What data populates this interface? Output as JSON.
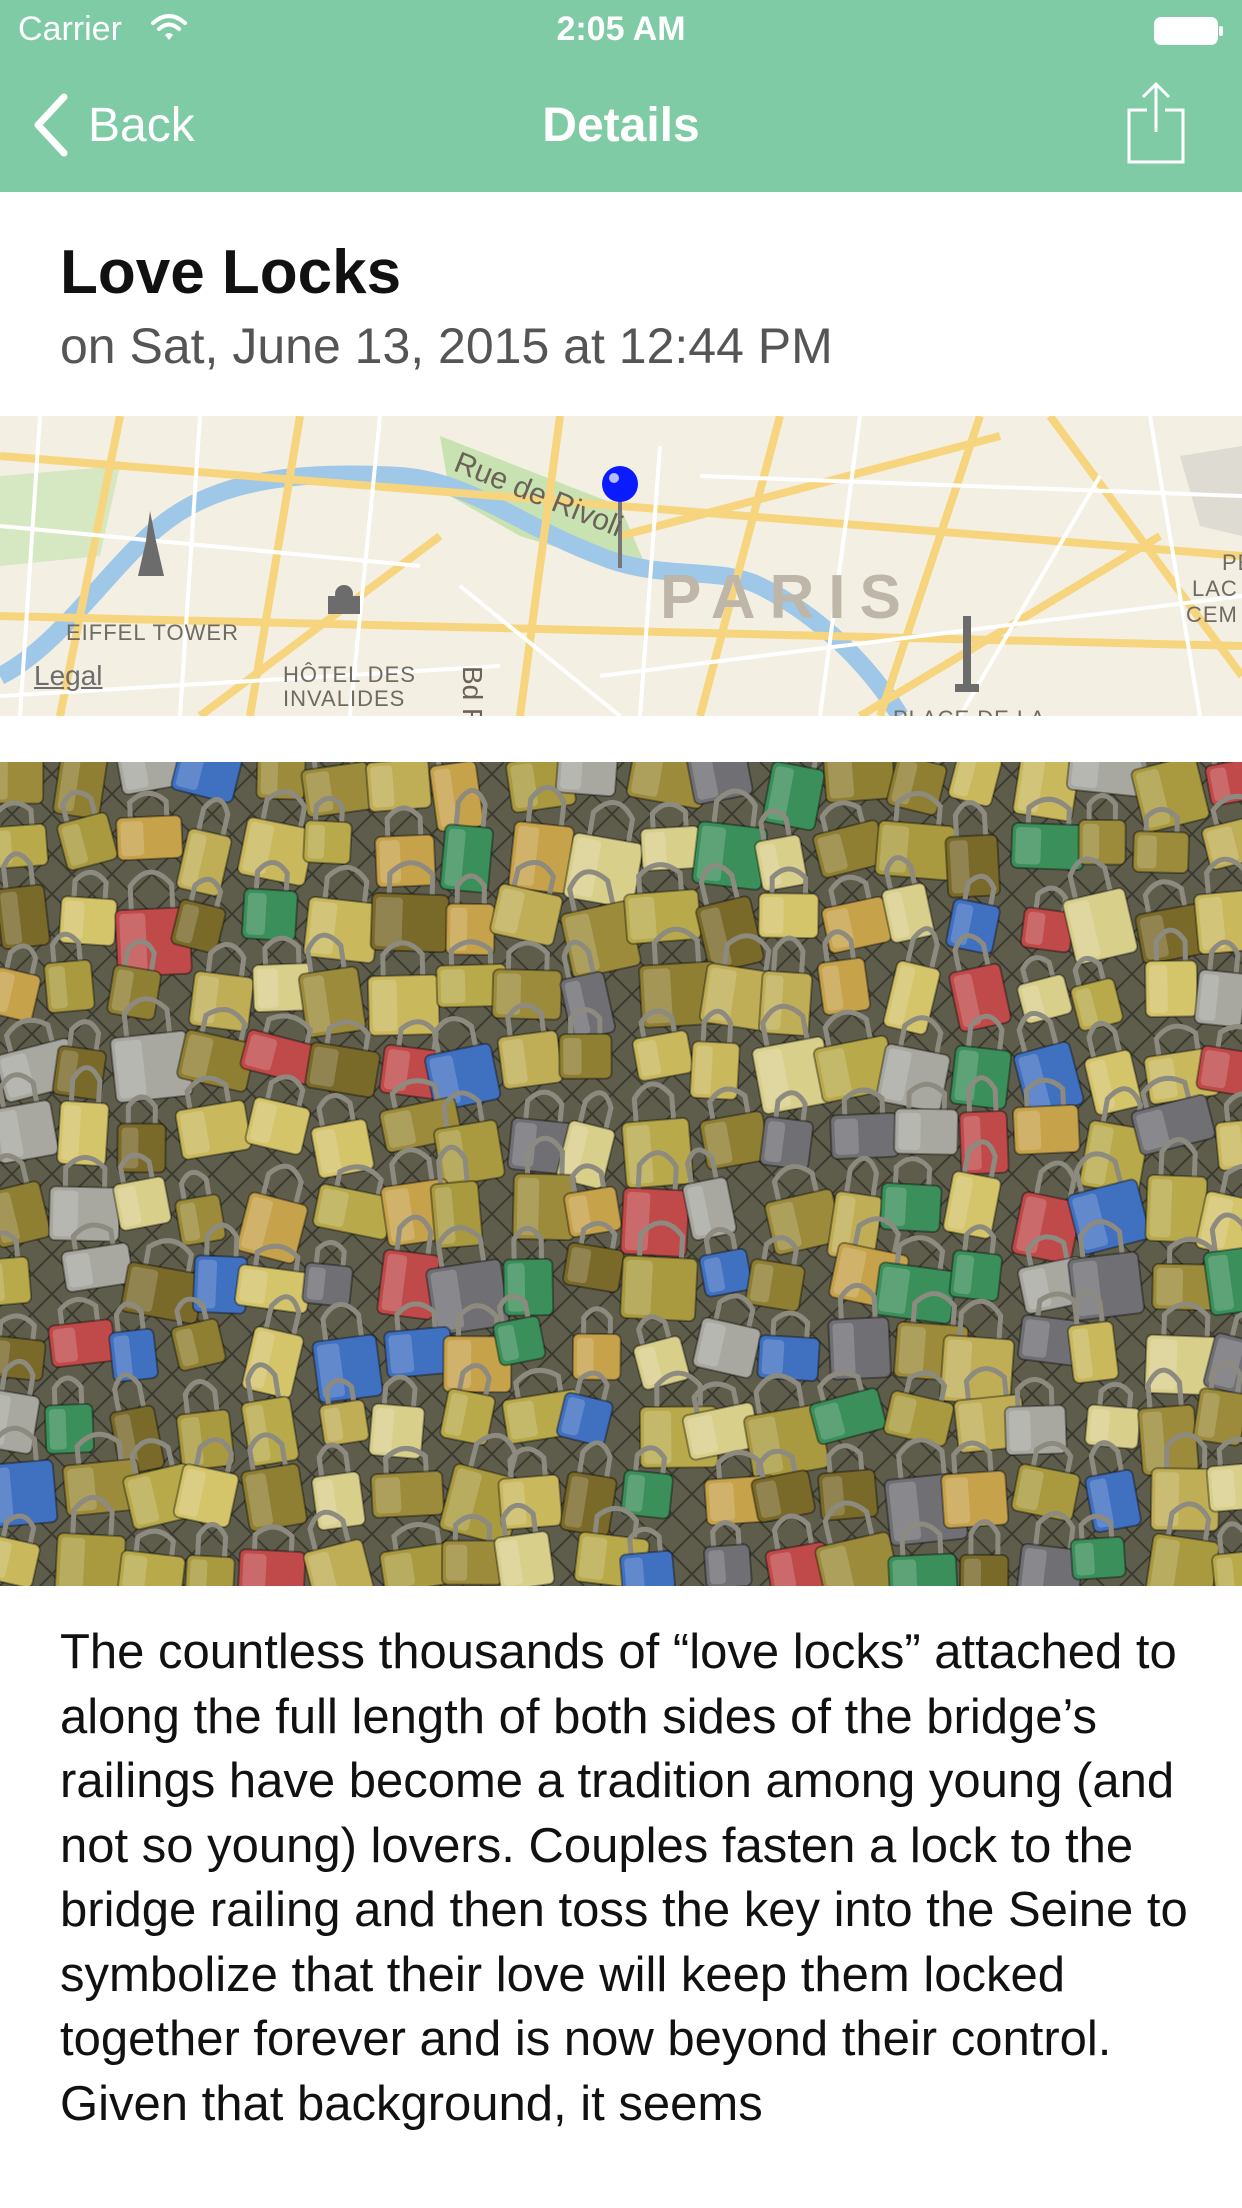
{
  "status_bar": {
    "carrier": "Carrier",
    "time": "2:05 AM",
    "wifi_icon": "wifi-icon",
    "battery_icon": "battery-icon"
  },
  "nav": {
    "back_label": "Back",
    "title": "Details",
    "share_icon": "share-icon",
    "background_color": "#7fcba5"
  },
  "entry": {
    "title": "Love Locks",
    "date": "on Sat, June 13, 2015 at 12:44 PM",
    "body": "The countless thousands of “love locks” attached to along the full length of both sides of the bridge’s railings have become a tradition among young (and not so young) lovers. Couples fasten a lock to the bridge railing and then toss the key into the Seine to symbolize that their love will keep them locked together forever and is now beyond their control. Given that background, it seems"
  },
  "map": {
    "street_label": "Rue de Rivoli",
    "street_label_2": "Bd R",
    "city_label": "PARIS",
    "landmark_1": "EIFFEL TOWER",
    "landmark_2_line1": "HÔTEL DES",
    "landmark_2_line2": "INVALIDES",
    "landmark_3": "PLACE DE LA",
    "landmark_4_line1": "PÈ",
    "landmark_4_line2": "LAC",
    "landmark_4_line3": "CEM",
    "legal": "Legal",
    "pin_color": "#0a1bff"
  },
  "photo": {
    "subject": "love locks padlocks on bridge railing"
  }
}
